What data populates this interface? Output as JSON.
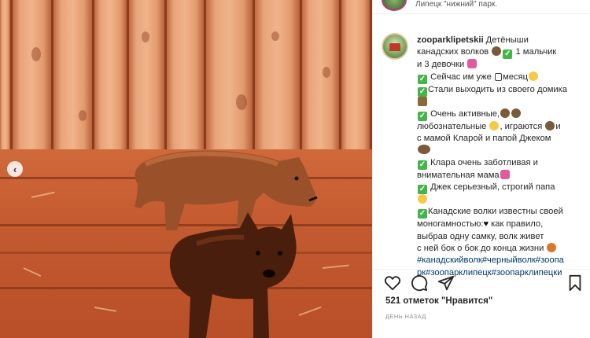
{
  "header": {
    "location": "Липецк \"нижний\" парк."
  },
  "caption": {
    "username": "zooparklipetskii",
    "lines": [
      "Детёныши",
      "канадских волков",
      "1 мальчик",
      "и 3 девочки",
      "Сейчас им уже",
      "месяц",
      "Стали выходить из своего домика",
      "Очень активные,",
      "любознательные",
      ", играются",
      "и",
      "с мамой Кларой и папой Джеком",
      "Клара очень заботливая и",
      "внимательная мама",
      "Джек серьезный, строгий папа",
      "Канадские волки известны своей",
      "моногамностью:",
      "как правило,",
      "выбрав одну самку, волк живет",
      "с ней бок о бок до конца жизни"
    ],
    "hashtags": [
      "#канадскийволк#черныйволк#зоопа",
      "рк#зоопарклипецк#зоопарклипецки"
    ]
  },
  "actions": {
    "like_icon": "heart-icon",
    "comment_icon": "comment-icon",
    "share_icon": "share-icon",
    "save_icon": "bookmark-icon"
  },
  "likes": "521 отметок \"Нравится\"",
  "time_ago": "ДЕНЬ НАЗАД",
  "colors": {
    "hashtag": "#00376b",
    "text": "#262626",
    "muted": "#8e8e8e"
  }
}
